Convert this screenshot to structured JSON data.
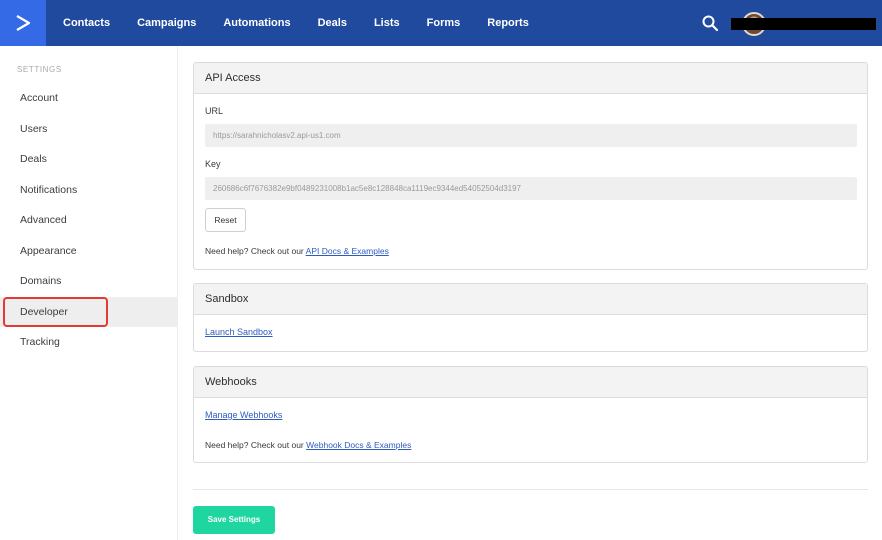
{
  "topbar": {
    "nav": [
      "Contacts",
      "Campaigns",
      "Automations",
      "Deals",
      "Lists",
      "Forms",
      "Reports"
    ],
    "logo_icon": "chevron-right-icon",
    "search_icon": "search-icon",
    "colors": {
      "bar": "#1f4a9e",
      "logo_bg": "#356ae6"
    }
  },
  "sidebar": {
    "heading": "SETTINGS",
    "items": [
      "Account",
      "Users",
      "Deals",
      "Notifications",
      "Advanced",
      "Appearance",
      "Domains",
      "Developer",
      "Tracking"
    ],
    "active": "Developer",
    "highlight_color": "#e53935"
  },
  "api_access": {
    "title": "API Access",
    "url_label": "URL",
    "url_value": "https://sarahnicholasv2.api-us1.com",
    "key_label": "Key",
    "key_value": "260686c6f7676382e9bf0489231008b1ac5e8c128848ca1119ec9344ed54052504d3197",
    "reset_label": "Reset",
    "help_prefix": "Need help? Check out our",
    "help_link": "API Docs & Examples"
  },
  "sandbox": {
    "title": "Sandbox",
    "link": "Launch Sandbox"
  },
  "webhooks": {
    "title": "Webhooks",
    "link": "Manage Webhooks",
    "help_prefix": "Need help? Check out our",
    "help_link": "Webhook Docs & Examples"
  },
  "save_label": "Save Settings",
  "accent_color": "#1fd6a1"
}
